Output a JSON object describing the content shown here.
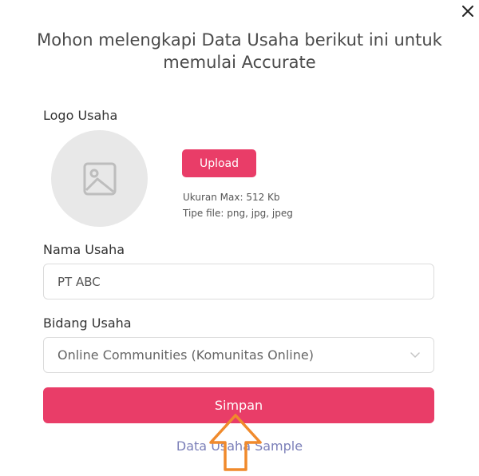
{
  "dialog": {
    "title": "Mohon melengkapi Data Usaha berikut ini untuk memulai Accurate",
    "close_icon": "close-icon",
    "accent_color": "#e93d68"
  },
  "logo": {
    "label": "Logo Usaha",
    "placeholder_icon": "image-icon",
    "upload_label": "Upload",
    "max_size": "Ukuran Max: 512 Kb",
    "file_types": "Tipe file: png, jpg, jpeg"
  },
  "nama_usaha": {
    "label": "Nama Usaha",
    "value": "PT ABC"
  },
  "bidang_usaha": {
    "label": "Bidang Usaha",
    "selected": "Online Communities (Komunitas Online)",
    "dropdown_icon": "chevron-down-icon"
  },
  "actions": {
    "submit_label": "Simpan",
    "sample_link": "Data Usaha Sample"
  },
  "annotation": {
    "icon": "up-arrow-icon",
    "color": "#f08a2c"
  }
}
